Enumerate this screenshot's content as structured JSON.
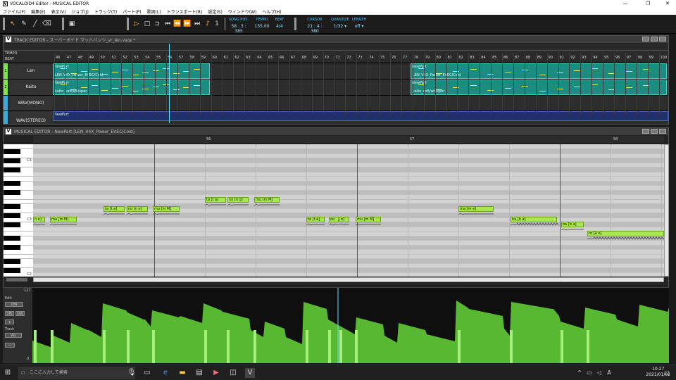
{
  "window": {
    "title": "VOCALOID4 Editor - MUSICAL EDITOR",
    "minimize": "—",
    "maximize": "❐",
    "close": "✕"
  },
  "menu": [
    "ファイル(F)",
    "編集(E)",
    "表示(V)",
    "ジョブ(J)",
    "トラック(T)",
    "パート(P)",
    "歌詞(L)",
    "トランスポート(R)",
    "設定(S)",
    "ウィンドウ(W)",
    "ヘルプ(H)"
  ],
  "toolbar": {
    "song_pos_label": "SONG POS.",
    "song_pos": "58 : 3 : 385",
    "tempo_label": "TEMPO",
    "tempo": "155.00",
    "beat_label": "BEAT",
    "beat": "4/4",
    "cursor_label": "CURSOR",
    "cursor": "21 : 4 : 380",
    "quantize_label": "QUANTIZE",
    "quantize": "1/32 ▾",
    "length_label": "LENGTH",
    "length": "off ▾"
  },
  "track_editor": {
    "title": "TRACK EDITOR - スーパーボイド マッハパンツ_vr_len.vsqx *",
    "tempo_label": "TEMPO",
    "beat_label": "BEAT",
    "measures": [
      "46",
      "47",
      "48",
      "49",
      "50",
      "51",
      "52",
      "53",
      "54",
      "55",
      "56",
      "57",
      "58",
      "59",
      "60",
      "61",
      "62",
      "63",
      "64",
      "65",
      "66",
      "67",
      "68",
      "69",
      "70",
      "71",
      "72",
      "73",
      "74",
      "75",
      "76",
      "77",
      "78",
      "79",
      "80",
      "81",
      "82",
      "83",
      "84",
      "85",
      "86",
      "87",
      "88",
      "89",
      "90",
      "91",
      "92",
      "93",
      "94",
      "95",
      "96",
      "97",
      "98",
      "99",
      "100"
    ],
    "tracks": [
      {
        "num": "1",
        "name": "Len",
        "color": "#7ee24a"
      },
      {
        "num": "2",
        "name": "Kaito",
        "color": "#7ee24a"
      },
      {
        "num": "",
        "name": "WAV(MONO)",
        "color": "#3aaad8"
      },
      {
        "num": "",
        "name": "WAV(STEREO)",
        "color": "#3aaad8"
      }
    ],
    "parts": [
      {
        "name": "NewPart",
        "singer": "LEN_V4X_Power_EVEC/Cold"
      },
      {
        "name": "NewPart",
        "singer": "LEN_V4X_Power_EVEC/Cold"
      },
      {
        "name": "NewPart",
        "singer": "kaito_soft/whisper"
      },
      {
        "name": "NewPart",
        "singer": "kaito_soft/whisper"
      },
      {
        "name": "NewPart",
        "singer": ""
      }
    ]
  },
  "musical_editor": {
    "title": "MUSICAL EDITOR - NewPart [LEN_V4X_Power_EVEC/Cold]",
    "measures": [
      "56",
      "57",
      "58"
    ],
    "key_labels": [
      "C4",
      "C3",
      "C2"
    ],
    "notes": [
      "n o]",
      "mu [m M]",
      "ta [t a]",
      "no [n o]",
      "mu [m M]",
      "ta [t a]",
      "no [n o]",
      "mu [m M]",
      "ta [t a]",
      "no",
      "o]",
      "mu [m M]",
      "ma [m a]",
      "ha [h a]",
      "ba [b a]",
      "ro [4 o]"
    ]
  },
  "control": {
    "top_value": "127",
    "bottom_value": "0",
    "edit_label": "Edit",
    "dyn": "DYN",
    "ope": "OPE",
    "gwl": "GWL",
    "track_label": "Track",
    "vel": "VEL"
  },
  "taskbar": {
    "search": "ここに入力して検索",
    "time": "10:27",
    "date": "2021/01/02",
    "ime": "A"
  }
}
